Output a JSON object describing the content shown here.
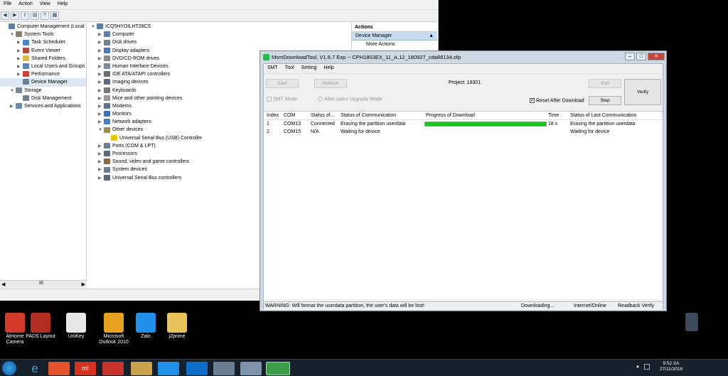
{
  "cm": {
    "menu": [
      "File",
      "Action",
      "View",
      "Help"
    ],
    "left": [
      {
        "arrow": "",
        "label": "Computer Management (Local",
        "icon": "computer-icon",
        "indent": 0
      },
      {
        "arrow": "▼",
        "label": "System Tools",
        "icon": "tools-icon",
        "indent": 1
      },
      {
        "arrow": "▶",
        "label": "Task Scheduler",
        "icon": "clock-icon",
        "indent": 2
      },
      {
        "arrow": "▶",
        "label": "Event Viewer",
        "icon": "event-icon",
        "indent": 2
      },
      {
        "arrow": "▶",
        "label": "Shared Folders",
        "icon": "folder-icon",
        "indent": 2
      },
      {
        "arrow": "▶",
        "label": "Local Users and Groups",
        "icon": "users-icon",
        "indent": 2
      },
      {
        "arrow": "▶",
        "label": "Performance",
        "icon": "performance-icon",
        "indent": 2
      },
      {
        "arrow": "",
        "label": "Device Manager",
        "icon": "device-icon",
        "indent": 2
      },
      {
        "arrow": "▼",
        "label": "Storage",
        "icon": "storage-icon",
        "indent": 1
      },
      {
        "arrow": "",
        "label": "Disk Management",
        "icon": "disk-icon",
        "indent": 2
      },
      {
        "arrow": "▶",
        "label": "Services and Applications",
        "icon": "services-icon",
        "indent": 1
      }
    ],
    "devices": [
      {
        "arrow": "▼",
        "label": "ICQ5HYOILHT28CS",
        "icon": "computer-icon",
        "indent": 0
      },
      {
        "arrow": "▶",
        "label": "Computer",
        "icon": "computer-icon",
        "indent": 1
      },
      {
        "arrow": "▶",
        "label": "Disk drives",
        "icon": "disk-icon",
        "indent": 1
      },
      {
        "arrow": "▶",
        "label": "Display adapters",
        "icon": "display-icon",
        "indent": 1
      },
      {
        "arrow": "▶",
        "label": "DVD/CD-ROM drives",
        "icon": "dvd-icon",
        "indent": 1
      },
      {
        "arrow": "▶",
        "label": "Human Interface Devices",
        "icon": "hid-icon",
        "indent": 1
      },
      {
        "arrow": "▶",
        "label": "IDE ATA/ATAPI controllers",
        "icon": "ide-icon",
        "indent": 1
      },
      {
        "arrow": "▶",
        "label": "Imaging devices",
        "icon": "camera-icon",
        "indent": 1
      },
      {
        "arrow": "▶",
        "label": "Keyboards",
        "icon": "keyboard-icon",
        "indent": 1
      },
      {
        "arrow": "▶",
        "label": "Mice and other pointing devices",
        "icon": "mouse-icon",
        "indent": 1
      },
      {
        "arrow": "▶",
        "label": "Modems",
        "icon": "modem-icon",
        "indent": 1
      },
      {
        "arrow": "▶",
        "label": "Monitors",
        "icon": "monitor-icon",
        "indent": 1
      },
      {
        "arrow": "▶",
        "label": "Network adapters",
        "icon": "network-icon",
        "indent": 1
      },
      {
        "arrow": "▼",
        "label": "Other devices",
        "icon": "other-icon",
        "indent": 1
      },
      {
        "arrow": "",
        "label": "Universal Serial Bus (USB) Controller",
        "icon": "warning-icon",
        "indent": 2
      },
      {
        "arrow": "▶",
        "label": "Ports (COM & LPT)",
        "icon": "port-icon",
        "indent": 1
      },
      {
        "arrow": "▶",
        "label": "Processors",
        "icon": "cpu-icon",
        "indent": 1
      },
      {
        "arrow": "▶",
        "label": "Sound, video and game controllers",
        "icon": "sound-icon",
        "indent": 1
      },
      {
        "arrow": "▶",
        "label": "System devices",
        "icon": "system-icon",
        "indent": 1
      },
      {
        "arrow": "▶",
        "label": "Universal Serial Bus controllers",
        "icon": "usb-icon",
        "indent": 1
      }
    ],
    "actions_title": "Actions",
    "actions_item": "Device Manager",
    "actions_more": "More Actions"
  },
  "msm": {
    "title": "MsmDownloadTool, V1.6.7 Exp -- CPH1803EX_11_A.12_180927_cda88134.ofp",
    "menu": [
      "SMT",
      "Tool",
      "Setting",
      "Help"
    ],
    "start": "Start",
    "refresh": "Refresh",
    "project": "Project: 18301",
    "exit": "Exit",
    "verify": "Verify",
    "smt_mode": "SMT Mode",
    "after_sales": "After-sales Upgrade Mode",
    "reset_after": "Reset After Download",
    "stop": "Stop",
    "headers": [
      "Index",
      "COM",
      "Status of...",
      "Status of Communication",
      "Progress of Download",
      "Time",
      "Status of Last Communication"
    ],
    "rows": [
      {
        "index": "1",
        "com": "COM13",
        "status": "Connected",
        "comm": "Erasing the partition  userdata",
        "progress": 1.0,
        "time": "18 s",
        "last": "Erasing the partition  userdata"
      },
      {
        "index": "2",
        "com": "COM15",
        "status": "N/A",
        "comm": "Waiting for device",
        "progress": 0,
        "time": "",
        "last": "Waiting for device"
      }
    ],
    "warning": "WARNING: Will format the userdata partition, the user's data will be lost!",
    "downloading": "Downloading...",
    "online": "Internet/Online",
    "readback": "Readback Verify",
    "progress_color": "#1ec21e"
  },
  "desktop": [
    {
      "label": "AtHome Camera",
      "color": "#d33a2c"
    },
    {
      "label": "PADS Layout",
      "color": "#b32d22"
    },
    {
      "label": "UniKey",
      "color": "#e8e8e8"
    },
    {
      "label": "Microsoft Outlook 2010",
      "color": "#e8a020"
    },
    {
      "label": "Zalo",
      "color": "#1f8fe8"
    },
    {
      "label": "j2prime",
      "color": "#e8c35a"
    }
  ],
  "tray": {
    "time": "9:52 SA",
    "date": "27/11/2018"
  }
}
